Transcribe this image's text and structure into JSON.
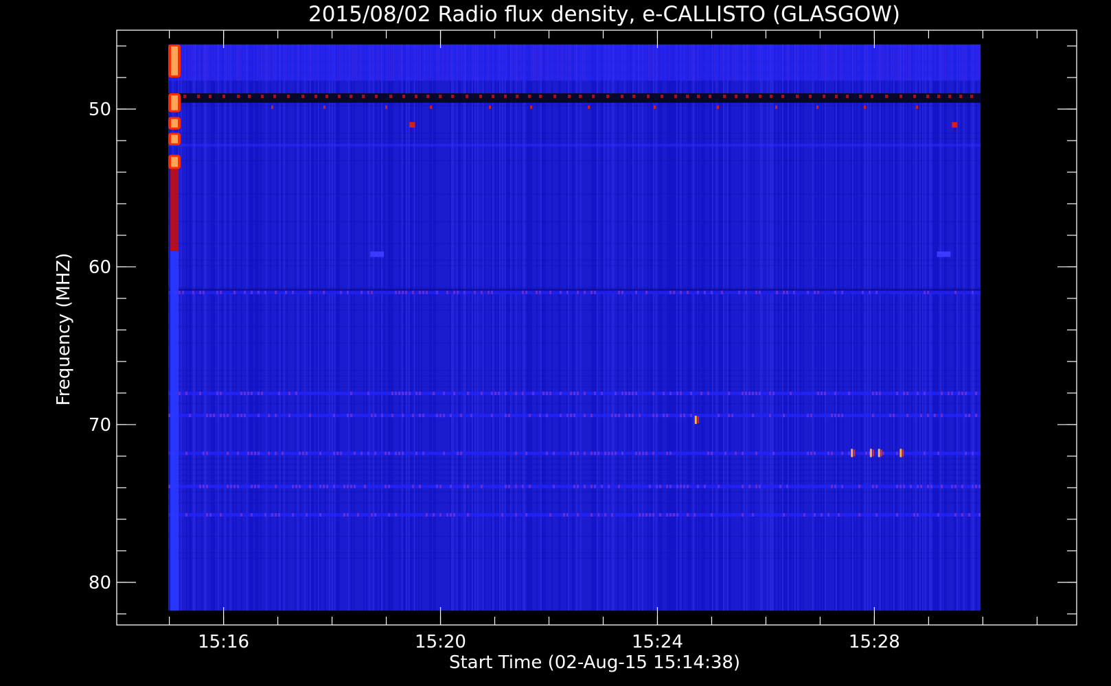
{
  "chart_data": {
    "type": "heatmap",
    "title": "2015/08/02  Radio flux density, e-CALLISTO (GLASGOW)",
    "xlabel": "Start Time (02-Aug-15 15:14:38)",
    "ylabel": "Frequency (MHZ)",
    "x_axis": {
      "unit": "minutes after 15:14:38",
      "range_minutes": [
        -0.6,
        17.1
      ],
      "data_start_minutes": 0.35,
      "data_end_minutes": 15.33,
      "major_ticks": [
        {
          "minutes": 1.37,
          "label": "15:16"
        },
        {
          "minutes": 5.37,
          "label": "15:20"
        },
        {
          "minutes": 9.37,
          "label": "15:24"
        },
        {
          "minutes": 13.37,
          "label": "15:28"
        }
      ],
      "minor_tick_step_minutes": 1
    },
    "y_axis": {
      "unit": "MHz",
      "range": [
        45.0,
        82.7
      ],
      "data_range": [
        45.9,
        81.8
      ],
      "inverted": true,
      "major_ticks": [
        50,
        60,
        70,
        80
      ],
      "minor_tick_step": 2
    },
    "colormap": [
      "#000000",
      "#1414ff",
      "#ff1a00",
      "#ffd07a"
    ],
    "background_level_color": "#1b1bd0",
    "features": {
      "burst_column_minutes": 0.35,
      "burst_hot_segments_mhz": [
        [
          45.9,
          48.0
        ],
        [
          49.0,
          50.2
        ],
        [
          50.5,
          51.3
        ],
        [
          51.5,
          52.3
        ],
        [
          52.9,
          53.8
        ]
      ],
      "burst_warm_range_mhz": [
        53.8,
        59.0
      ],
      "burst_blue_tail_mhz": [
        59.0,
        81.8
      ],
      "dark_band_mhz": [
        49.0,
        49.6
      ],
      "bright_upper_band_mhz": [
        45.9,
        48.2
      ],
      "rfi_lines_mhz": [
        61.6,
        68.0,
        69.4,
        71.8,
        73.9,
        75.7
      ],
      "red_dots": [
        {
          "minutes": 4.85,
          "mhz": 51.0
        },
        {
          "minutes": 14.85,
          "mhz": 51.0
        }
      ],
      "blue_marks": [
        {
          "minutes": 4.2,
          "mhz": 59.2
        },
        {
          "minutes": 14.65,
          "mhz": 59.2
        }
      ],
      "spikes": [
        {
          "minutes": 10.07,
          "mhz": 69.7
        },
        {
          "minutes": 12.95,
          "mhz": 71.8
        },
        {
          "minutes": 13.3,
          "mhz": 71.8
        },
        {
          "minutes": 13.45,
          "mhz": 71.8
        },
        {
          "minutes": 13.85,
          "mhz": 71.8
        }
      ]
    }
  }
}
